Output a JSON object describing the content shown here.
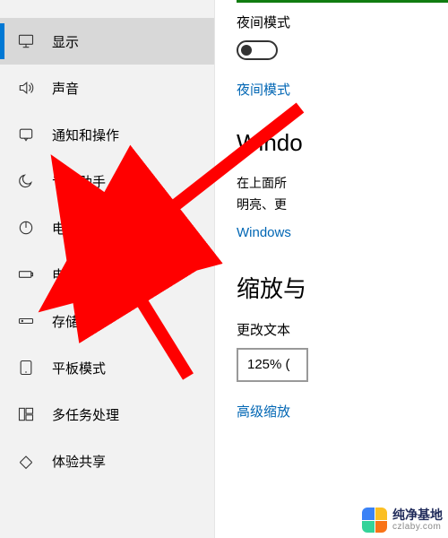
{
  "sidebar": {
    "items": [
      {
        "label": "显示",
        "icon": "monitor-icon",
        "active": true
      },
      {
        "label": "声音",
        "icon": "sound-icon",
        "active": false
      },
      {
        "label": "通知和操作",
        "icon": "notification-icon",
        "active": false
      },
      {
        "label": "专注助手",
        "icon": "moon-icon",
        "active": false
      },
      {
        "label": "电源和睡眠",
        "icon": "power-icon",
        "active": false
      },
      {
        "label": "电池",
        "icon": "battery-icon",
        "active": false
      },
      {
        "label": "存储",
        "icon": "storage-icon",
        "active": false
      },
      {
        "label": "平板模式",
        "icon": "tablet-icon",
        "active": false
      },
      {
        "label": "多任务处理",
        "icon": "multitask-icon",
        "active": false
      },
      {
        "label": "体验共享",
        "icon": "share-icon",
        "active": false
      }
    ]
  },
  "content": {
    "night_light_label": "夜间模式",
    "night_light_toggle": false,
    "night_light_settings_link": "夜间模式",
    "hd_heading": "Windo",
    "hd_body_line1": "在上面所",
    "hd_body_line2": "明亮、更",
    "hd_link": "Windows",
    "scale_heading": "缩放与",
    "scale_field_label": "更改文本",
    "scale_value": "125% (",
    "scale_advanced_link": "高级缩放"
  },
  "watermark": {
    "line1": "纯净基地",
    "line2": "czlaby.com"
  },
  "colors": {
    "accent": "#0078d4",
    "link": "#0066b4",
    "green": "#107c10",
    "arrow": "#ff0000"
  }
}
